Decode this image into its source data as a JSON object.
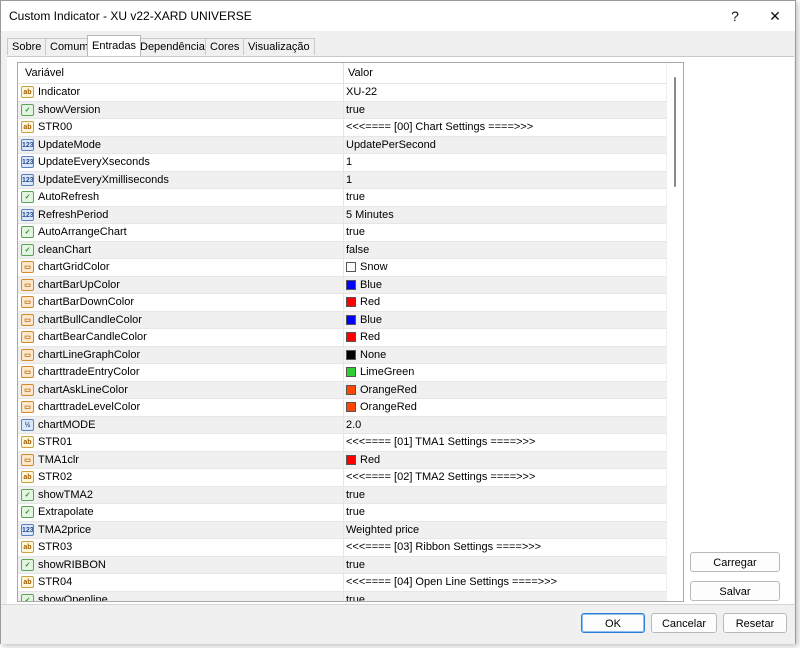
{
  "window": {
    "title": "Custom Indicator - XU v22-XARD UNIVERSE",
    "help_label": "?",
    "close_label": "✕"
  },
  "tabs": [
    "Sobre",
    "Comum",
    "Entradas",
    "Dependências",
    "Cores",
    "Visualização"
  ],
  "active_tab": "Entradas",
  "grid": {
    "headers": {
      "variable": "Variável",
      "value": "Valor"
    },
    "rows": [
      {
        "icon": "ab",
        "name": "Indicator",
        "value": "XU-22"
      },
      {
        "icon": "bool",
        "name": "showVersion",
        "value": "true"
      },
      {
        "icon": "ab",
        "name": "STR00",
        "value": "<<<==== [00] Chart Settings ====>>>"
      },
      {
        "icon": "num",
        "name": "UpdateMode",
        "value": "UpdatePerSecond"
      },
      {
        "icon": "num",
        "name": "UpdateEveryXseconds",
        "value": "1"
      },
      {
        "icon": "num",
        "name": "UpdateEveryXmilliseconds",
        "value": "1"
      },
      {
        "icon": "bool",
        "name": "AutoRefresh",
        "value": "true"
      },
      {
        "icon": "num",
        "name": "RefreshPeriod",
        "value": "5 Minutes"
      },
      {
        "icon": "bool",
        "name": "AutoArrangeChart",
        "value": "true"
      },
      {
        "icon": "bool",
        "name": "cleanChart",
        "value": "false"
      },
      {
        "icon": "color",
        "name": "chartGridColor",
        "value": "Snow",
        "swatch": "#fffafa"
      },
      {
        "icon": "color",
        "name": "chartBarUpColor",
        "value": "Blue",
        "swatch": "#0000ff"
      },
      {
        "icon": "color",
        "name": "chartBarDownColor",
        "value": "Red",
        "swatch": "#ff0000"
      },
      {
        "icon": "color",
        "name": "chartBullCandleColor",
        "value": "Blue",
        "swatch": "#0000ff"
      },
      {
        "icon": "color",
        "name": "chartBearCandleColor",
        "value": "Red",
        "swatch": "#ff0000"
      },
      {
        "icon": "color",
        "name": "chartLineGraphColor",
        "value": "None",
        "swatch": "#000000"
      },
      {
        "icon": "color",
        "name": "charttradeEntryColor",
        "value": "LimeGreen",
        "swatch": "#32cd32"
      },
      {
        "icon": "color",
        "name": "chartAskLineColor",
        "value": "OrangeRed",
        "swatch": "#ff4500"
      },
      {
        "icon": "color",
        "name": "charttradeLevelColor",
        "value": "OrangeRed",
        "swatch": "#ff4500"
      },
      {
        "icon": "dbl",
        "name": "chartMODE",
        "value": "2.0"
      },
      {
        "icon": "ab",
        "name": "STR01",
        "value": "<<<==== [01] TMA1 Settings ====>>>"
      },
      {
        "icon": "color",
        "name": "TMA1clr",
        "value": "Red",
        "swatch": "#ff0000"
      },
      {
        "icon": "ab",
        "name": "STR02",
        "value": "<<<==== [02] TMA2 Settings ====>>>"
      },
      {
        "icon": "bool",
        "name": "showTMA2",
        "value": "true"
      },
      {
        "icon": "bool",
        "name": "Extrapolate",
        "value": "true"
      },
      {
        "icon": "num",
        "name": "TMA2price",
        "value": "Weighted price"
      },
      {
        "icon": "ab",
        "name": "STR03",
        "value": "<<<==== [03] Ribbon Settings ====>>>"
      },
      {
        "icon": "bool",
        "name": "showRIBBON",
        "value": "true"
      },
      {
        "icon": "ab",
        "name": "STR04",
        "value": "<<<==== [04] Open Line Settings ====>>>"
      },
      {
        "icon": "bool",
        "name": "showOpenline",
        "value": "true"
      }
    ]
  },
  "icon_glyphs": {
    "ab": "ab",
    "bool": "✓",
    "num": "123",
    "color": "▭",
    "dbl": "½"
  },
  "buttons": {
    "load": "Carregar",
    "save": "Salvar",
    "ok": "OK",
    "cancel": "Cancelar",
    "reset": "Resetar"
  }
}
